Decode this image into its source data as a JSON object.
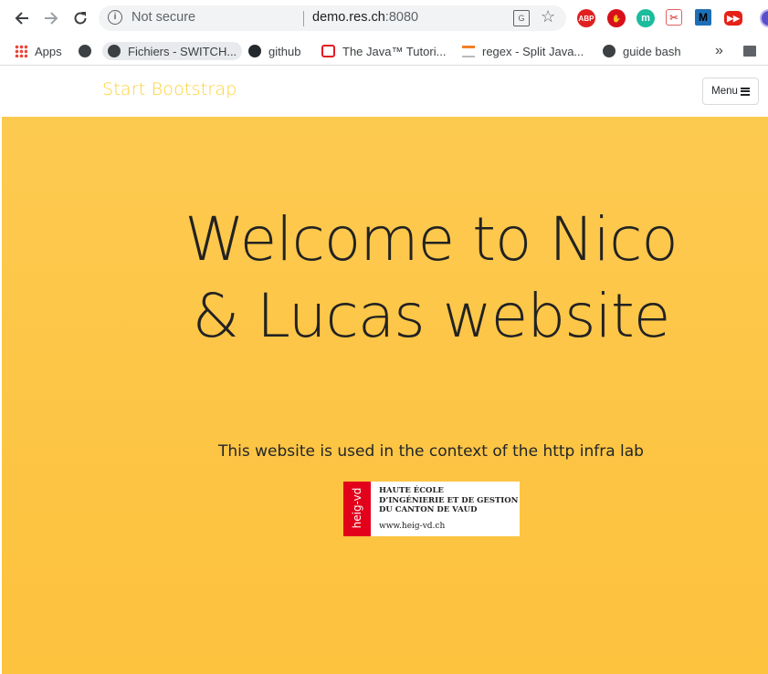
{
  "browser": {
    "address_security": "Not secure",
    "address_host": "demo.res.ch",
    "address_port": ":8080",
    "bookmarks": {
      "apps": "Apps",
      "fichiers": "Fichiers - SWITCH...",
      "github": "github",
      "java": "The Java™ Tutori...",
      "regex": "regex - Split Java...",
      "guide": "guide bash",
      "more": "»"
    },
    "extensions": {
      "abp": "ABP",
      "m_teal": "m",
      "m_blue": "M"
    }
  },
  "page": {
    "brand": "Start Bootstrap",
    "menu_label": "Menu",
    "headline": "Welcome to Nico & Lucas website",
    "subline": "This website is used in the context of the http infra lab",
    "logo": {
      "vertical_text": "heig-vd",
      "line1": "HAUTE ÉCOLE",
      "line2": "D’INGÉNIERIE ET DE GESTION",
      "line3": "DU CANTON DE VAUD",
      "site": "www.heig-vd.ch"
    }
  },
  "colors": {
    "hero_background": "#fdc545",
    "brand_yellow": "#fed136",
    "heig_red": "#e2001a"
  }
}
